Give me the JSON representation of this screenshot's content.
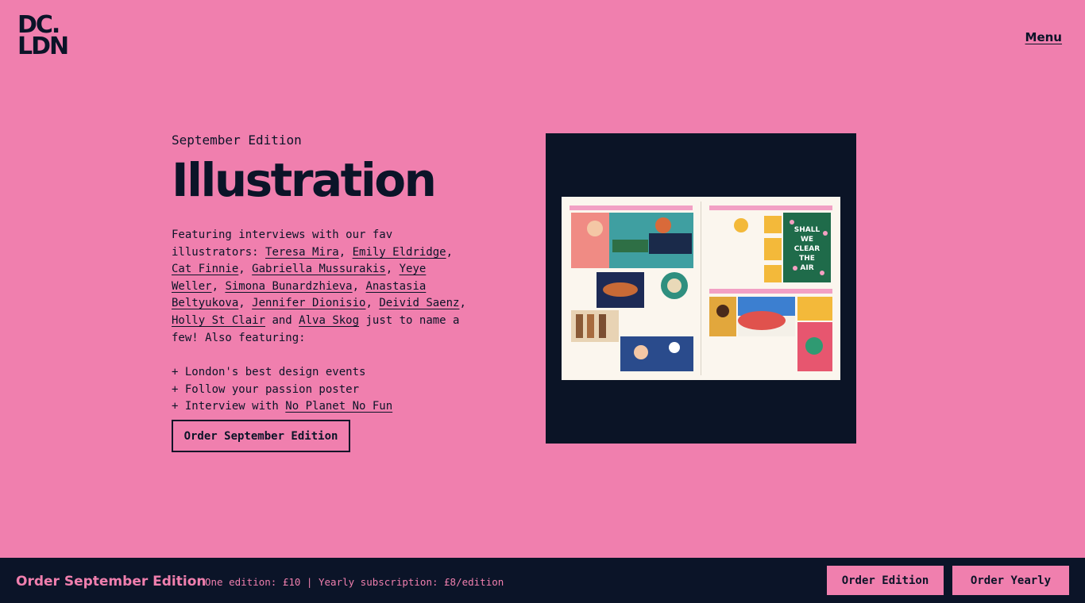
{
  "header": {
    "logo_line1": "DC.",
    "logo_line2": "LDN",
    "menu_label": "Menu"
  },
  "hero": {
    "edition_label": "September Edition",
    "title": "Illustration",
    "intro_text": "Featuring interviews with our fav illustrators:",
    "illustrators": [
      "Teresa Mira",
      "Emily Eldridge",
      "Cat Finnie",
      "Gabriella Mussurakis",
      "Yeye Weller",
      "Simona Bunardzhieva",
      "Anastasia Beltyukova",
      "Jennifer Dionisio",
      "Deivid Saenz",
      "Holly St Clair",
      "Alva Skog"
    ],
    "sep_comma": ", ",
    "sep_and": " and ",
    "outro_text": " just to name a few! Also featuring:",
    "features": [
      "+ London's best design events",
      "+ Follow your passion poster",
      "+ Interview with "
    ],
    "feature_link": "No Planet No Fun",
    "order_button": "Order September Edition"
  },
  "preview": {
    "art_text": [
      "SHALL",
      "WE",
      "CLEAR",
      "THE",
      "AIR"
    ]
  },
  "bottom_bar": {
    "title": "Order September Edition",
    "prices": "One edition: £10 | Yearly subscription: £8/edition",
    "order_edition_button": "Order Edition",
    "order_yearly_button": "Order Yearly"
  },
  "colors": {
    "background": "#f07fae",
    "navy": "#0b1428"
  },
  "icons": {
    "logo": "dc-ldn-logo"
  }
}
